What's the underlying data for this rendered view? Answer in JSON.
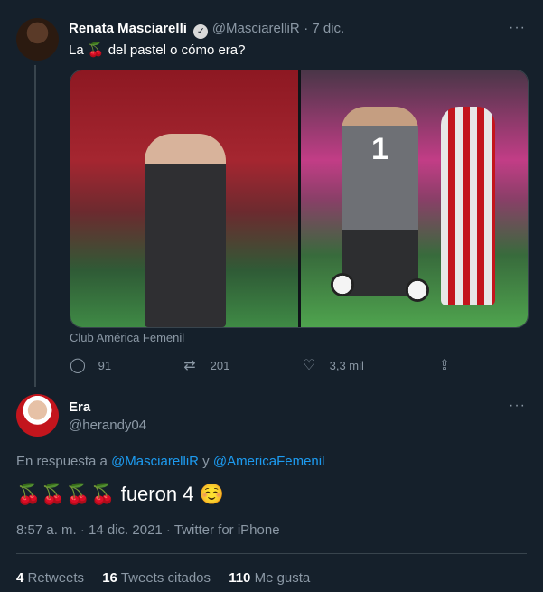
{
  "tweet1": {
    "display_name": "Renata Masciarelli",
    "handle": "@MasciarelliR",
    "time": "· 7 dic.",
    "text_before": "La",
    "emoji": "🍒",
    "text_after": "del pastel o cómo era?",
    "media_caption": "Club América Femenil",
    "jersey_number": "1",
    "replies": "91",
    "retweets": "201",
    "likes": "3,3 mil",
    "more": "···"
  },
  "tweet2": {
    "display_name": "Era",
    "handle": "@herandy04",
    "more": "···",
    "reply_label": "En respuesta a",
    "reply_user1": "@MasciarelliR",
    "reply_and": "y",
    "reply_user2": "@AmericaFemenil",
    "emojis": "🍒🍒🍒🍒",
    "text": "fueron 4",
    "emoji_end": "☺️",
    "timestamp": "8:57 a. m. · 14 dic. 2021 · Twitter for iPhone",
    "retweets_count": "4",
    "retweets_label": "Retweets",
    "quotes_count": "16",
    "quotes_label": "Tweets citados",
    "likes_count": "110",
    "likes_label": "Me gusta"
  },
  "icons": {
    "reply": "reply-icon",
    "retweet": "retweet-icon",
    "like": "like-icon",
    "share": "share-icon",
    "verified": "verified-badge-icon"
  },
  "colors": {
    "background": "#15202b",
    "link": "#1d9bf0",
    "muted": "#8b98a5",
    "border": "#38444d"
  }
}
